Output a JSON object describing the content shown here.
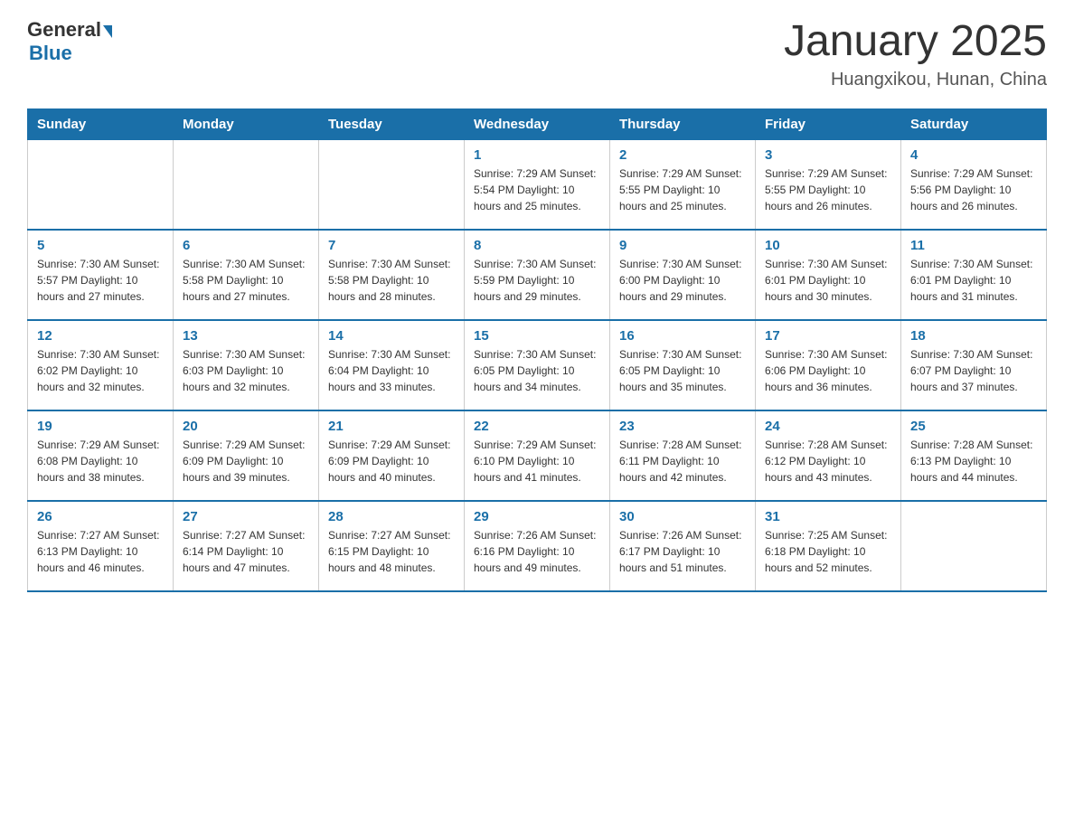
{
  "header": {
    "logo_general": "General",
    "logo_blue": "Blue",
    "title": "January 2025",
    "subtitle": "Huangxikou, Hunan, China"
  },
  "days_of_week": [
    "Sunday",
    "Monday",
    "Tuesday",
    "Wednesday",
    "Thursday",
    "Friday",
    "Saturday"
  ],
  "weeks": [
    [
      {
        "day": "",
        "info": ""
      },
      {
        "day": "",
        "info": ""
      },
      {
        "day": "",
        "info": ""
      },
      {
        "day": "1",
        "info": "Sunrise: 7:29 AM\nSunset: 5:54 PM\nDaylight: 10 hours\nand 25 minutes."
      },
      {
        "day": "2",
        "info": "Sunrise: 7:29 AM\nSunset: 5:55 PM\nDaylight: 10 hours\nand 25 minutes."
      },
      {
        "day": "3",
        "info": "Sunrise: 7:29 AM\nSunset: 5:55 PM\nDaylight: 10 hours\nand 26 minutes."
      },
      {
        "day": "4",
        "info": "Sunrise: 7:29 AM\nSunset: 5:56 PM\nDaylight: 10 hours\nand 26 minutes."
      }
    ],
    [
      {
        "day": "5",
        "info": "Sunrise: 7:30 AM\nSunset: 5:57 PM\nDaylight: 10 hours\nand 27 minutes."
      },
      {
        "day": "6",
        "info": "Sunrise: 7:30 AM\nSunset: 5:58 PM\nDaylight: 10 hours\nand 27 minutes."
      },
      {
        "day": "7",
        "info": "Sunrise: 7:30 AM\nSunset: 5:58 PM\nDaylight: 10 hours\nand 28 minutes."
      },
      {
        "day": "8",
        "info": "Sunrise: 7:30 AM\nSunset: 5:59 PM\nDaylight: 10 hours\nand 29 minutes."
      },
      {
        "day": "9",
        "info": "Sunrise: 7:30 AM\nSunset: 6:00 PM\nDaylight: 10 hours\nand 29 minutes."
      },
      {
        "day": "10",
        "info": "Sunrise: 7:30 AM\nSunset: 6:01 PM\nDaylight: 10 hours\nand 30 minutes."
      },
      {
        "day": "11",
        "info": "Sunrise: 7:30 AM\nSunset: 6:01 PM\nDaylight: 10 hours\nand 31 minutes."
      }
    ],
    [
      {
        "day": "12",
        "info": "Sunrise: 7:30 AM\nSunset: 6:02 PM\nDaylight: 10 hours\nand 32 minutes."
      },
      {
        "day": "13",
        "info": "Sunrise: 7:30 AM\nSunset: 6:03 PM\nDaylight: 10 hours\nand 32 minutes."
      },
      {
        "day": "14",
        "info": "Sunrise: 7:30 AM\nSunset: 6:04 PM\nDaylight: 10 hours\nand 33 minutes."
      },
      {
        "day": "15",
        "info": "Sunrise: 7:30 AM\nSunset: 6:05 PM\nDaylight: 10 hours\nand 34 minutes."
      },
      {
        "day": "16",
        "info": "Sunrise: 7:30 AM\nSunset: 6:05 PM\nDaylight: 10 hours\nand 35 minutes."
      },
      {
        "day": "17",
        "info": "Sunrise: 7:30 AM\nSunset: 6:06 PM\nDaylight: 10 hours\nand 36 minutes."
      },
      {
        "day": "18",
        "info": "Sunrise: 7:30 AM\nSunset: 6:07 PM\nDaylight: 10 hours\nand 37 minutes."
      }
    ],
    [
      {
        "day": "19",
        "info": "Sunrise: 7:29 AM\nSunset: 6:08 PM\nDaylight: 10 hours\nand 38 minutes."
      },
      {
        "day": "20",
        "info": "Sunrise: 7:29 AM\nSunset: 6:09 PM\nDaylight: 10 hours\nand 39 minutes."
      },
      {
        "day": "21",
        "info": "Sunrise: 7:29 AM\nSunset: 6:09 PM\nDaylight: 10 hours\nand 40 minutes."
      },
      {
        "day": "22",
        "info": "Sunrise: 7:29 AM\nSunset: 6:10 PM\nDaylight: 10 hours\nand 41 minutes."
      },
      {
        "day": "23",
        "info": "Sunrise: 7:28 AM\nSunset: 6:11 PM\nDaylight: 10 hours\nand 42 minutes."
      },
      {
        "day": "24",
        "info": "Sunrise: 7:28 AM\nSunset: 6:12 PM\nDaylight: 10 hours\nand 43 minutes."
      },
      {
        "day": "25",
        "info": "Sunrise: 7:28 AM\nSunset: 6:13 PM\nDaylight: 10 hours\nand 44 minutes."
      }
    ],
    [
      {
        "day": "26",
        "info": "Sunrise: 7:27 AM\nSunset: 6:13 PM\nDaylight: 10 hours\nand 46 minutes."
      },
      {
        "day": "27",
        "info": "Sunrise: 7:27 AM\nSunset: 6:14 PM\nDaylight: 10 hours\nand 47 minutes."
      },
      {
        "day": "28",
        "info": "Sunrise: 7:27 AM\nSunset: 6:15 PM\nDaylight: 10 hours\nand 48 minutes."
      },
      {
        "day": "29",
        "info": "Sunrise: 7:26 AM\nSunset: 6:16 PM\nDaylight: 10 hours\nand 49 minutes."
      },
      {
        "day": "30",
        "info": "Sunrise: 7:26 AM\nSunset: 6:17 PM\nDaylight: 10 hours\nand 51 minutes."
      },
      {
        "day": "31",
        "info": "Sunrise: 7:25 AM\nSunset: 6:18 PM\nDaylight: 10 hours\nand 52 minutes."
      },
      {
        "day": "",
        "info": ""
      }
    ]
  ]
}
